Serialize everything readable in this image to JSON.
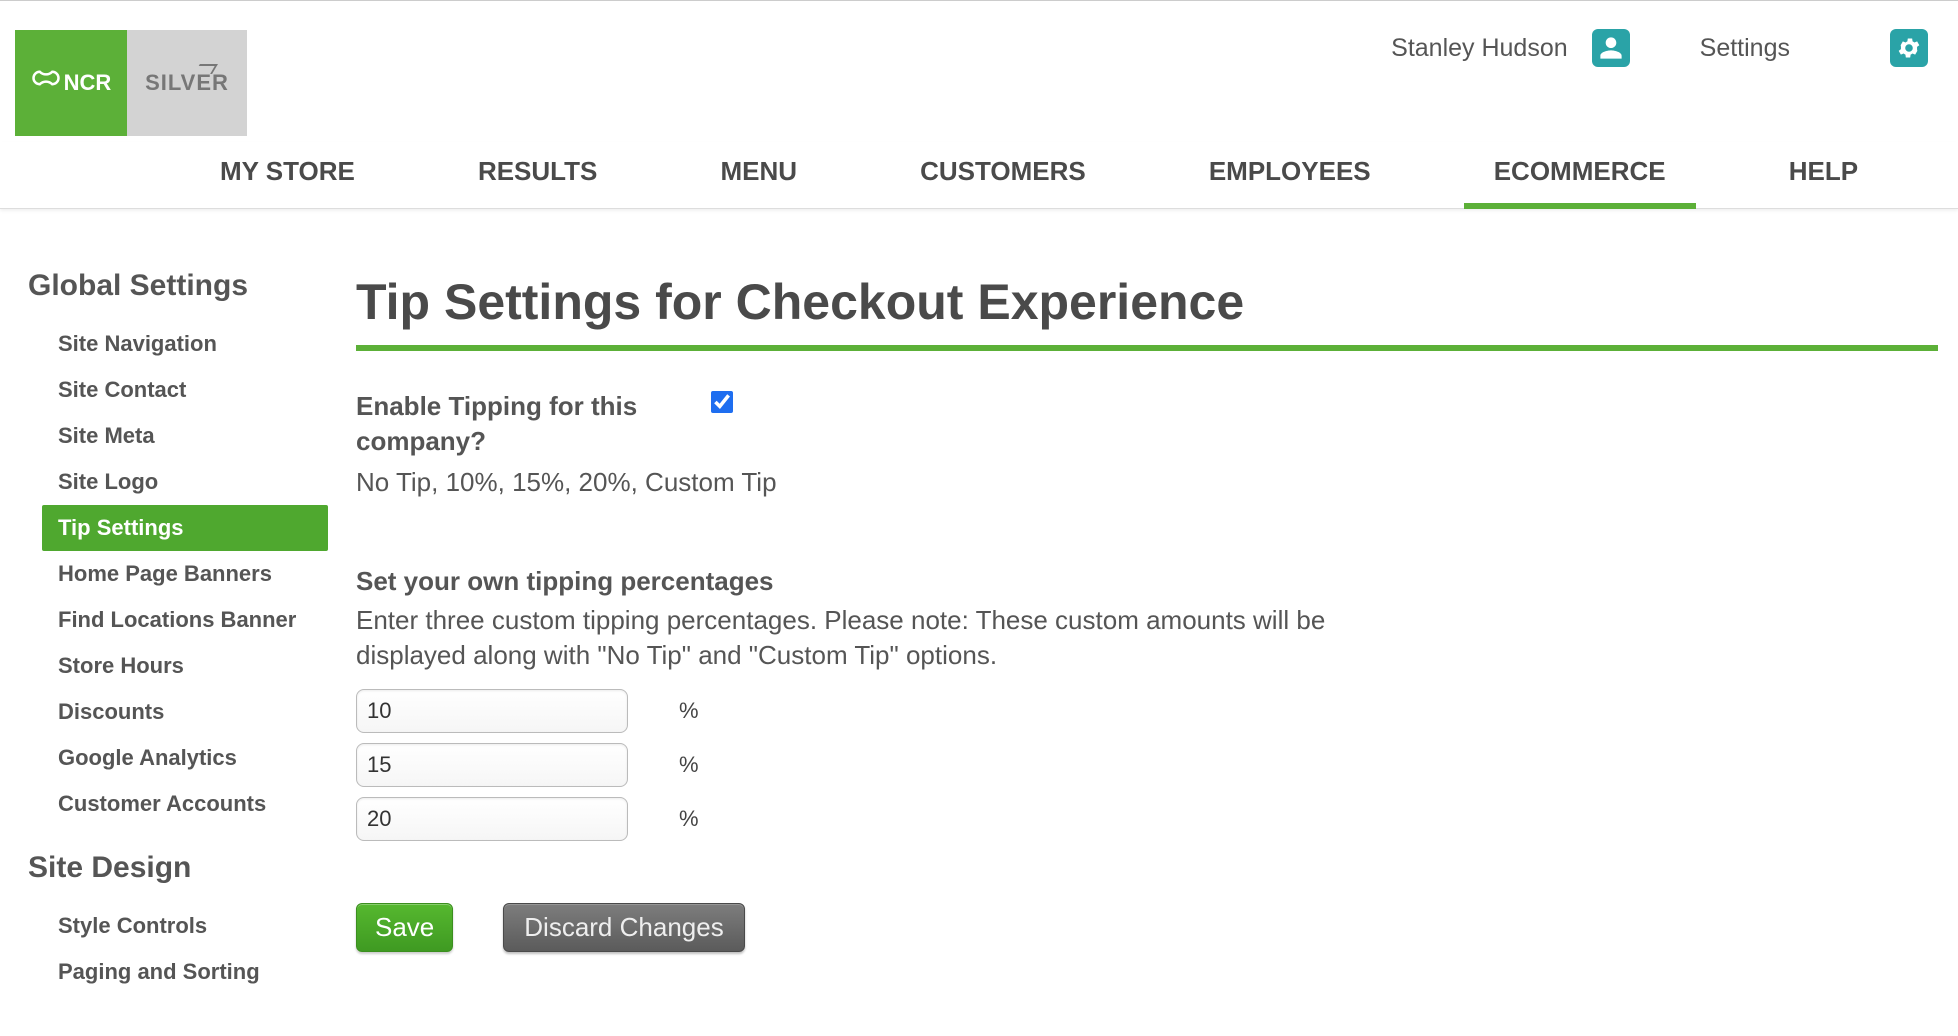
{
  "topbar": {
    "user_name": "Stanley Hudson",
    "settings_label": "Settings"
  },
  "logo": {
    "ncr_text": "NCR",
    "silver_text": "SILVER"
  },
  "nav": {
    "tabs": [
      {
        "label": "MY STORE",
        "active": false
      },
      {
        "label": "RESULTS",
        "active": false
      },
      {
        "label": "MENU",
        "active": false
      },
      {
        "label": "CUSTOMERS",
        "active": false
      },
      {
        "label": "EMPLOYEES",
        "active": false
      },
      {
        "label": "ECOMMERCE",
        "active": true
      },
      {
        "label": "HELP",
        "active": false
      }
    ]
  },
  "sidebar": {
    "section1_title": "Global Settings",
    "section2_title": "Site Design",
    "items1": [
      {
        "label": "Site Navigation",
        "active": false
      },
      {
        "label": "Site Contact",
        "active": false
      },
      {
        "label": "Site Meta",
        "active": false
      },
      {
        "label": "Site Logo",
        "active": false
      },
      {
        "label": "Tip Settings",
        "active": true
      },
      {
        "label": "Home Page Banners",
        "active": false
      },
      {
        "label": "Find Locations Banner",
        "active": false
      },
      {
        "label": "Store Hours",
        "active": false
      },
      {
        "label": "Discounts",
        "active": false
      },
      {
        "label": "Google Analytics",
        "active": false
      },
      {
        "label": "Customer Accounts",
        "active": false
      }
    ],
    "items2": [
      {
        "label": "Style Controls",
        "active": false
      },
      {
        "label": "Paging and Sorting",
        "active": false
      }
    ]
  },
  "main": {
    "title": "Tip Settings for Checkout Experience",
    "enable_label": "Enable Tipping for this company?",
    "enable_checked": true,
    "presets_text": "No Tip, 10%, 15%, 20%, Custom Tip",
    "own_heading": "Set your own tipping percentages",
    "own_help": "Enter three custom tipping percentages. Please note: These custom amounts will be displayed along with \"No Tip\" and \"Custom Tip\" options.",
    "pct_values": [
      "10",
      "15",
      "20"
    ],
    "pct_suffix": "%",
    "save_label": "Save",
    "discard_label": "Discard Changes"
  }
}
